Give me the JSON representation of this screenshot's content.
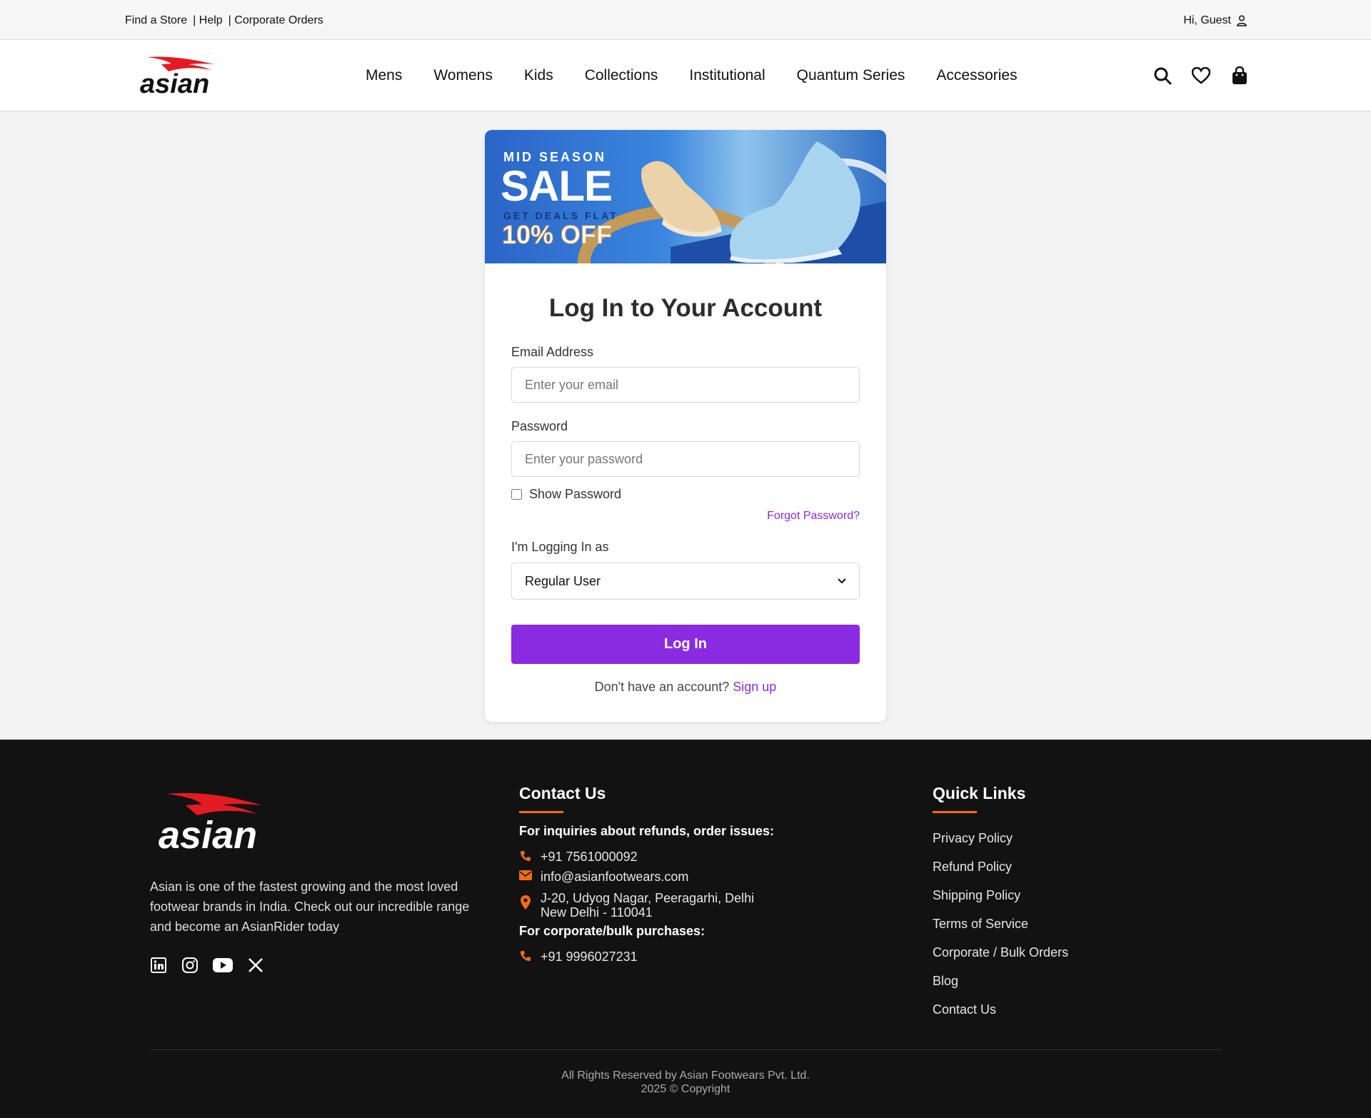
{
  "topbar": {
    "find_store": "Find a Store",
    "help": "| Help",
    "corporate": "| Corporate Orders",
    "greeting": "Hi, Guest"
  },
  "nav": {
    "items": [
      "Mens",
      "Womens",
      "Kids",
      "Collections",
      "Institutional",
      "Quantum Series",
      "Accessories"
    ]
  },
  "banner": {
    "line1": "MID SEASON",
    "line2": "SALE",
    "line3": "GET DEALS FLAT",
    "line4": "10% OFF"
  },
  "login": {
    "title": "Log In to Your Account",
    "email_label": "Email Address",
    "email_placeholder": "Enter your email",
    "password_label": "Password",
    "password_placeholder": "Enter your password",
    "show_password": "Show Password",
    "forgot": "Forgot Password?",
    "role_label": "I'm Logging In as",
    "role_value": "Regular User",
    "button": "Log In",
    "no_account": "Don't have an account?",
    "signup": "Sign up"
  },
  "footer": {
    "description": "Asian is one of the fastest growing and the most loved footwear brands in India. Check out our incredible range and become an AsianRider today",
    "contact_title": "Contact Us",
    "inquiries_title": "For inquiries about refunds, order issues:",
    "phone1": "+91 7561000092",
    "email": "info@asianfootwears.com",
    "address_line1": "J-20, Udyog Nagar, Peeragarhi, Delhi",
    "address_line2": "New Delhi - 110041",
    "corporate_title": "For corporate/bulk purchases:",
    "phone2": "+91 9996027231",
    "quick_links_title": "Quick Links",
    "quick_links": [
      "Privacy Policy",
      "Refund Policy",
      "Shipping Policy",
      "Terms of Service",
      "Corporate / Bulk Orders",
      "Blog",
      "Contact Us"
    ],
    "rights": "All Rights Reserved by Asian Footwears Pvt. Ltd.",
    "copyright": "2025 © Copyright"
  },
  "colors": {
    "accent": "#8a2be2",
    "footer_bg": "#121212",
    "footer_accent": "#f26a1b",
    "brand_red": "#e31b23"
  },
  "icons": [
    "user-icon",
    "search-icon",
    "heart-icon",
    "bag-icon",
    "linkedin-icon",
    "instagram-icon",
    "youtube-icon",
    "x-icon",
    "phone-icon",
    "mail-icon",
    "location-icon",
    "chevron-down-icon"
  ]
}
